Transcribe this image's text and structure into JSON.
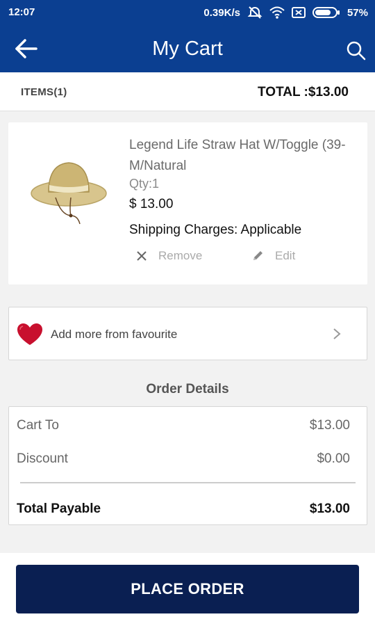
{
  "status_bar": {
    "time": "12:07",
    "speed": "0.39K/s",
    "battery": "57%",
    "icons": [
      "mute-icon",
      "wifi-icon",
      "sim-blocked-icon",
      "battery-icon"
    ]
  },
  "app_bar": {
    "title": "My Cart",
    "back_icon": "arrow-left-icon",
    "search_icon": "search-icon",
    "background": "#0b3f91"
  },
  "summary": {
    "items_label": "ITEMS(1)",
    "total_label": "TOTAL :$13.00"
  },
  "cart_items": [
    {
      "name_line1": "Legend Life Straw Hat W/Toggle (39-",
      "name_line2": "M/Natural",
      "qty": "Qty:1",
      "price": "$ 13.00",
      "shipping": "Shipping Charges: Applicable",
      "remove_label": "Remove",
      "edit_label": "Edit",
      "image": "straw-hat-image"
    }
  ],
  "favourite": {
    "label": "Add more from favourite",
    "icon": "heart-icon",
    "heart_color": "#c8102e"
  },
  "order_details": {
    "title": "Order Details",
    "cart_to_label": "Cart To",
    "cart_to_value": "$13.00",
    "discount_label": "Discount",
    "discount_value": "$0.00",
    "total_payable_label": "Total Payable",
    "total_payable_value": "$13.00"
  },
  "actions": {
    "place_order_label": "PLACE ORDER",
    "button_color": "#0a1f52"
  }
}
